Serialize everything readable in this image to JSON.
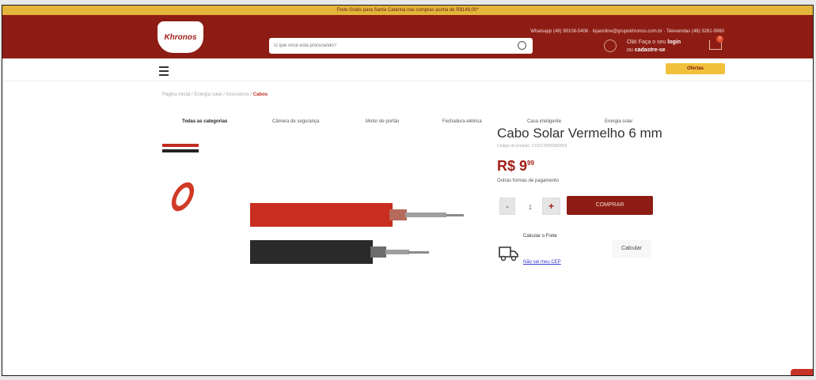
{
  "promo": "Frete Grátis para Santa Catarina nas compras acima de R$149,00*",
  "header": {
    "logo": "Khronos",
    "contact": "Whatsapp (48) 99108-5406 · lojaonline@grupokhronos.com.br · Televendas (48) 3261-9960",
    "search_placeholder": "O que você está procurando?",
    "login_prefix": "Olá! Faça o seu",
    "login_link": "login",
    "signup_prefix": "ou",
    "signup_link": "cadastre-se",
    "cart_count": "0"
  },
  "nav": {
    "all": "Todas as categorias",
    "items": [
      "Câmera de segurança",
      "Motor de portão",
      "Fechadura elétrica",
      "Casa inteligente",
      "Energia solar"
    ],
    "offers": "Ofertas"
  },
  "breadcrumb": {
    "path": "Página inicial / Energia solar / Acessórios / ",
    "current": "Cabos"
  },
  "product": {
    "title": "Cabo Solar Vermelho 6 mm",
    "code": "Código do produto: 2132170000000003",
    "price_main": "R$ 9",
    "price_cents": "99",
    "payment": "Outras formas de pagamento",
    "qty": "1",
    "minus": "-",
    "plus": "+",
    "buy": "COMPRAR",
    "freight_label": "Calcular o Frete",
    "calc_button": "Calcular",
    "no_cep": "Não sei meu CEP"
  },
  "colors": {
    "brand": "#8d1d14",
    "accent": "#f2c13c",
    "price": "#a11e15"
  }
}
